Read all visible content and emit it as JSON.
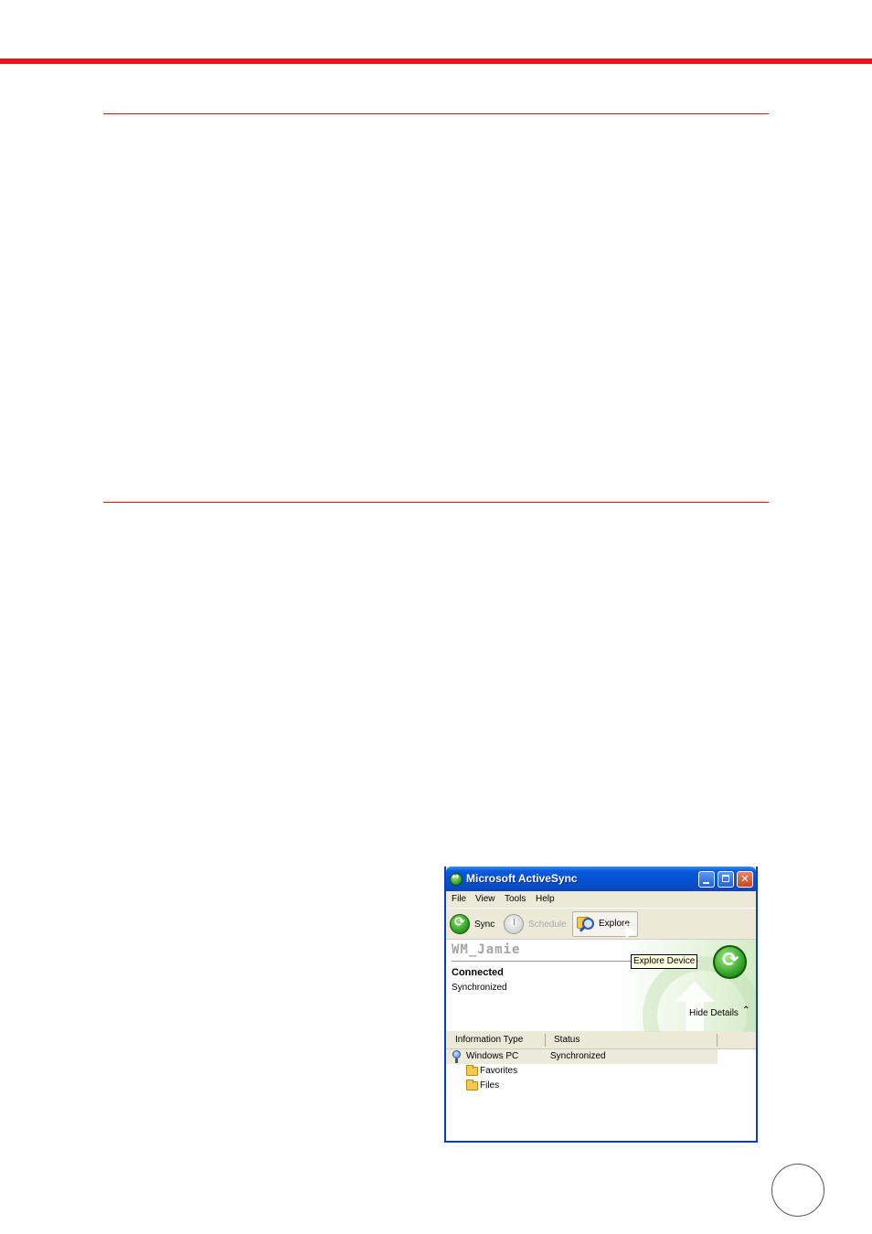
{
  "window": {
    "title": "Microsoft ActiveSync",
    "controls": {
      "minimize": "",
      "maximize": "",
      "close": "✕"
    }
  },
  "menu": [
    "File",
    "View",
    "Tools",
    "Help"
  ],
  "toolbar": {
    "sync_label": "Sync",
    "schedule_label": "Schedule",
    "explore_label": "Explore"
  },
  "device": {
    "name": "WM_Jamie",
    "connection_status": "Connected",
    "sync_status": "Synchronized",
    "tooltip": "Explore Device",
    "hide_details_label": "Hide Details"
  },
  "list": {
    "columns": [
      "Information Type",
      "Status"
    ],
    "rows": [
      {
        "type": "Windows PC",
        "status": "Synchronized",
        "icon": "computer-icon"
      },
      {
        "type": "Favorites",
        "status": "",
        "icon": "folder-icon"
      },
      {
        "type": "Files",
        "status": "",
        "icon": "folder-sync-icon"
      }
    ]
  },
  "colors": {
    "accent_red": "#e8141b",
    "titlebar_blue": "#0650d2",
    "sync_green": "#2b9a24"
  }
}
